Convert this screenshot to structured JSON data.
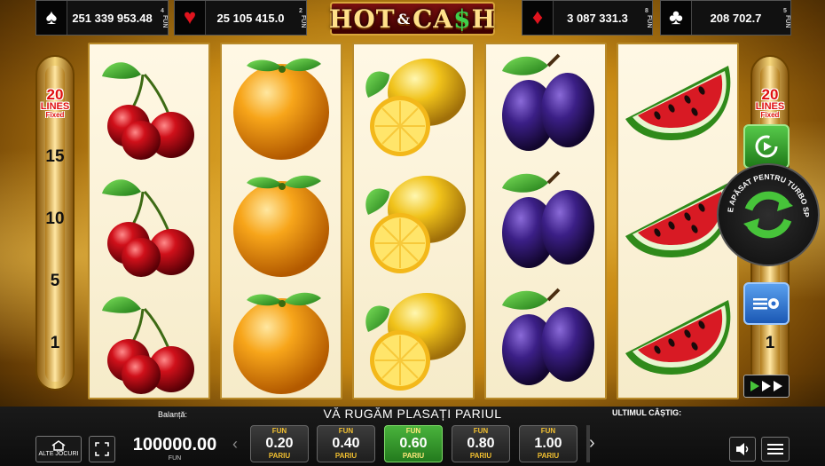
{
  "jackpots": [
    {
      "suit": "♠",
      "suit_name": "spade",
      "value": "251 339 953.48",
      "top": "4",
      "bottom": "FUN",
      "color": "#ffffff"
    },
    {
      "suit": "♥",
      "suit_name": "heart",
      "value": "25 105 415.0",
      "top": "2",
      "bottom": "FUN",
      "color": "#e0141e"
    },
    {
      "suit": "♦",
      "suit_name": "diamond",
      "value": "3 087 331.3",
      "top": "8",
      "bottom": "FUN",
      "color": "#e0141e"
    },
    {
      "suit": "♣",
      "suit_name": "club",
      "value": "208 702.7",
      "top": "5",
      "bottom": "FUN",
      "color": "#ffffff"
    }
  ],
  "logo": {
    "part1": "HOT",
    "amp": "&",
    "part2": "CA",
    "dollar": "$",
    "part3": "H"
  },
  "reels": [
    {
      "symbol": "cherry"
    },
    {
      "symbol": "orange"
    },
    {
      "symbol": "lemon"
    },
    {
      "symbol": "plum"
    },
    {
      "symbol": "watermelon"
    }
  ],
  "lines": {
    "count": "20",
    "word": "LINES",
    "fixed": "Fixed",
    "marks": [
      "15",
      "10",
      "5",
      "1"
    ]
  },
  "turbo": {
    "text": "ȚINE APĂSAT PENTRU TURBO SPIN"
  },
  "bottom": {
    "balance_label": "Balanță:",
    "balance_value": "100000.00",
    "balance_unit": "FUN",
    "message": "VĂ RUGĂM PLASAȚI PARIUL",
    "last_win_label": "ULTIMUL CÂȘTIG:",
    "other_games": "ALTE JOCURI",
    "bets": [
      {
        "fun": "FUN",
        "value": "0.20",
        "label": "PARIU"
      },
      {
        "fun": "FUN",
        "value": "0.40",
        "label": "PARIU"
      },
      {
        "fun": "FUN",
        "value": "0.60",
        "label": "PARIU",
        "selected": true
      },
      {
        "fun": "FUN",
        "value": "0.80",
        "label": "PARIU"
      },
      {
        "fun": "FUN",
        "value": "1.00",
        "label": "PARIU"
      }
    ]
  },
  "colors": {
    "accent_green": "#3fbf3a",
    "line_red": "#e01010",
    "gold": "#d9a53b"
  }
}
